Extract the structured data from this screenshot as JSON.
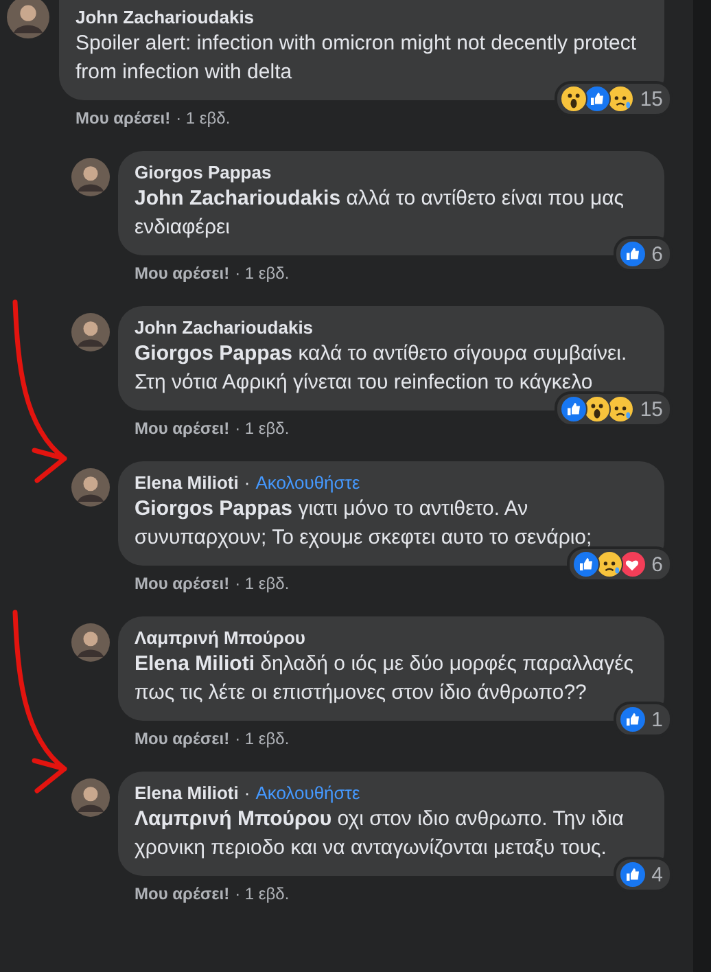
{
  "comments": [
    {
      "author": "John Zacharioudakis",
      "reply": false,
      "marked": false,
      "text": "Spoiler alert: infection with omicron might not decently protect from infection with delta",
      "like_label": "Μου αρέσει!",
      "time": "· 1 εβδ.",
      "reactions": [
        {
          "kind": "wow"
        },
        {
          "kind": "like"
        },
        {
          "kind": "sad"
        }
      ],
      "count": "15"
    },
    {
      "author": "Giorgos Pappas",
      "reply": true,
      "marked": false,
      "text": "**John Zacharioudakis** αλλά το αντίθετο είναι που μας ενδιαφέρει",
      "like_label": "Μου αρέσει!",
      "time": "· 1 εβδ.",
      "reactions": [
        {
          "kind": "like"
        }
      ],
      "count": "6"
    },
    {
      "author": "John Zacharioudakis",
      "reply": true,
      "marked": false,
      "text": "**Giorgos Pappas** καλά το αντίθετο σίγουρα συμβαίνει. Στη νότια Αφρική γίνεται του reinfection το κάγκελο",
      "like_label": "Μου αρέσει!",
      "time": "· 1 εβδ.",
      "reactions": [
        {
          "kind": "like"
        },
        {
          "kind": "wow"
        },
        {
          "kind": "sad"
        }
      ],
      "count": "15"
    },
    {
      "author": "Elena Milioti",
      "follow": {
        "separator": "·",
        "label": "Ακολουθήστε"
      },
      "reply": true,
      "marked": true,
      "text": "**Giorgos Pappas** γιατι μόνο το αντιθετο. Αν συνυπαρχουν; Το εχουμε σκεφτει αυτο το σενάριο;",
      "like_label": "Μου αρέσει!",
      "time": "· 1 εβδ.",
      "reactions": [
        {
          "kind": "like"
        },
        {
          "kind": "sad"
        },
        {
          "kind": "love"
        }
      ],
      "count": "6"
    },
    {
      "author": "Λαμπρινή Μπούρου",
      "reply": true,
      "marked": false,
      "text": "**Elena Milioti** δηλαδή ο ιός με δύο μορφές παραλλαγές πως τις λέτε οι επιστήμονες στον ίδιο άνθρωπο??",
      "like_label": "Μου αρέσει!",
      "time": "· 1 εβδ.",
      "reactions": [
        {
          "kind": "like"
        }
      ],
      "count": "1"
    },
    {
      "author": "Elena Milioti",
      "follow": {
        "separator": "·",
        "label": "Ακολουθήστε"
      },
      "reply": true,
      "marked": true,
      "text": "**Λαμπρινή Μπούρου** οχι στον ιδιο ανθρωπο. Την ιδια χρονικη περιοδο και να ανταγωνίζονται μεταξυ τους.",
      "like_label": "Μου αρέσει!",
      "time": "· 1 εβδ.",
      "reactions": [
        {
          "kind": "like"
        }
      ],
      "count": "4"
    }
  ]
}
